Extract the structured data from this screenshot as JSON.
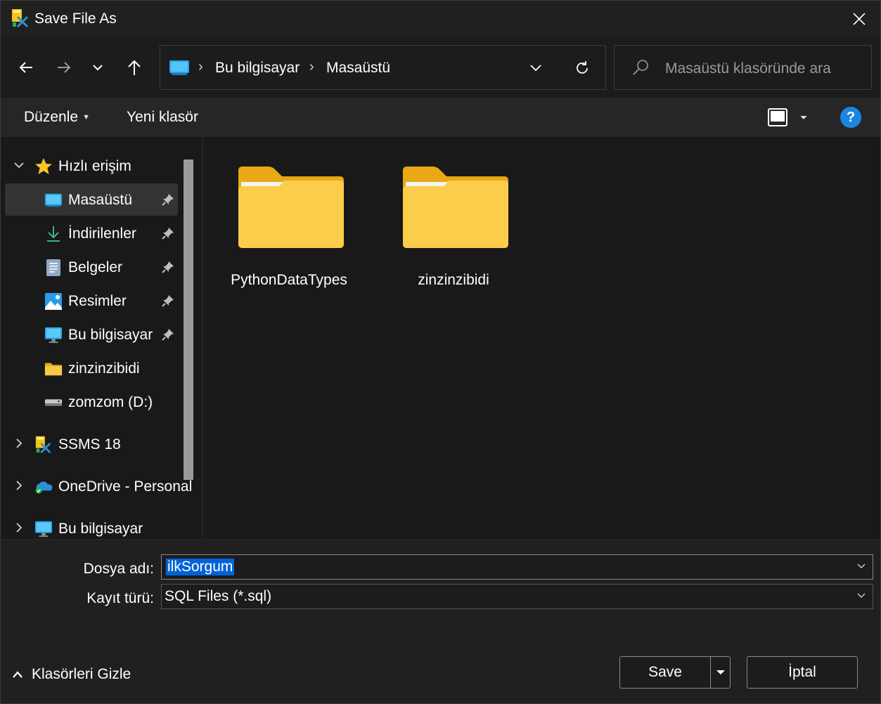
{
  "window": {
    "title": "Save File As",
    "close_label": "✕"
  },
  "nav": {
    "back_icon": "arrow-left-icon",
    "forward_icon": "arrow-right-icon",
    "recent_icon": "chevron-down-icon",
    "up_icon": "arrow-up-icon"
  },
  "address": {
    "breadcrumbs": [
      "Bu bilgisayar",
      "Masaüstü"
    ],
    "separator": "›"
  },
  "search": {
    "placeholder": "Masaüstü klasöründe ara"
  },
  "commandbar": {
    "organize_label": "Düzenle",
    "new_folder_label": "Yeni klasör",
    "help_label": "?"
  },
  "sidebar": {
    "quick_access": {
      "label": "Hızlı erişim",
      "items": [
        {
          "label": "Masaüstü",
          "icon": "desktop-icon",
          "pinned": true
        },
        {
          "label": "İndirilenler",
          "icon": "download-icon",
          "pinned": true
        },
        {
          "label": "Belgeler",
          "icon": "documents-icon",
          "pinned": true
        },
        {
          "label": "Resimler",
          "icon": "pictures-icon",
          "pinned": true
        },
        {
          "label": "Bu bilgisayar",
          "icon": "computer-icon",
          "pinned": true
        },
        {
          "label": "zinzinzibidi",
          "icon": "folder-icon",
          "pinned": false
        },
        {
          "label": "zomzom (D:)",
          "icon": "drive-icon",
          "pinned": false
        }
      ]
    },
    "roots": [
      {
        "label": "SSMS 18",
        "icon": "ssms-icon"
      },
      {
        "label": "OneDrive - Personal",
        "icon": "onedrive-icon"
      },
      {
        "label": "Bu bilgisayar",
        "icon": "computer-icon"
      }
    ]
  },
  "content": {
    "folders": [
      {
        "name": "PythonDataTypes"
      },
      {
        "name": "zinzinzibidi"
      }
    ]
  },
  "form": {
    "filename_label": "Dosya adı:",
    "filename_value": "ilkSorgum",
    "filetype_label": "Kayıt türü:",
    "filetype_value": "SQL Files (*.sql)"
  },
  "footer": {
    "hide_folders_label": "Klasörleri Gizle",
    "save_label": "Save",
    "cancel_label": "İptal"
  },
  "colors": {
    "background": "#191919",
    "accent": "#0063d8",
    "help": "#1a86e0",
    "folder": "#f9c846"
  }
}
